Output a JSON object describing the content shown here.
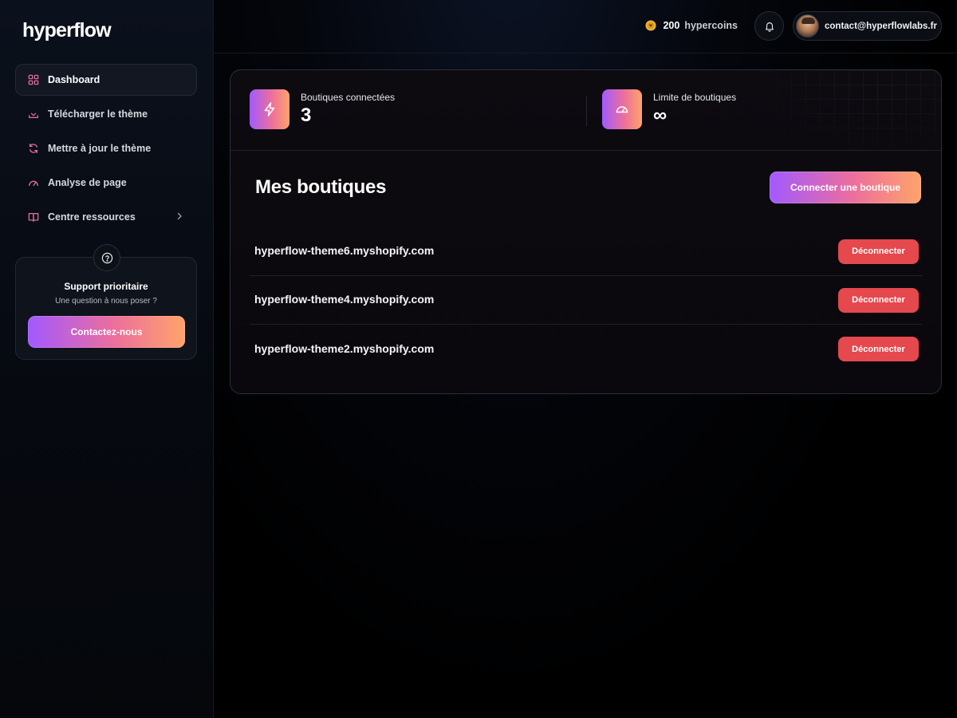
{
  "brand": {
    "logo_text": "hyperflow"
  },
  "sidebar": {
    "items": [
      {
        "label": "Dashboard",
        "icon": "dashboard-grid-icon",
        "active": true
      },
      {
        "label": "Télécharger le thème",
        "icon": "download-icon",
        "active": false
      },
      {
        "label": "Mettre à jour le thème",
        "icon": "refresh-icon",
        "active": false
      },
      {
        "label": "Analyse de page",
        "icon": "gauge-icon",
        "active": false
      },
      {
        "label": "Centre ressources",
        "icon": "book-icon",
        "active": false,
        "has_submenu": true
      }
    ],
    "support": {
      "title": "Support prioritaire",
      "subtitle": "Une question à nous poser ?",
      "button_label": "Contactez-nous",
      "icon": "help-circle-icon"
    }
  },
  "topbar": {
    "coins_count": "200",
    "coins_label": "hypercoins",
    "coin_icon": "coin-icon",
    "bell_icon": "bell-icon",
    "account_email": "contact@hyperflowlabs.fr"
  },
  "stats": [
    {
      "label": "Boutiques connectées",
      "value": "3",
      "icon": "lightning-icon"
    },
    {
      "label": "Limite de boutiques",
      "value": "∞",
      "icon": "speedometer-icon"
    }
  ],
  "shops_section": {
    "title": "Mes boutiques",
    "connect_button": "Connecter une boutique",
    "disconnect_label": "Déconnecter",
    "shops": [
      "hyperflow-theme6.myshopify.com",
      "hyperflow-theme4.myshopify.com",
      "hyperflow-theme2.myshopify.com"
    ]
  },
  "colors": {
    "accent_gradient_start": "#a259ff",
    "accent_gradient_mid": "#ec6f9c",
    "accent_gradient_end": "#ffa36b",
    "danger": "#e5484d"
  }
}
